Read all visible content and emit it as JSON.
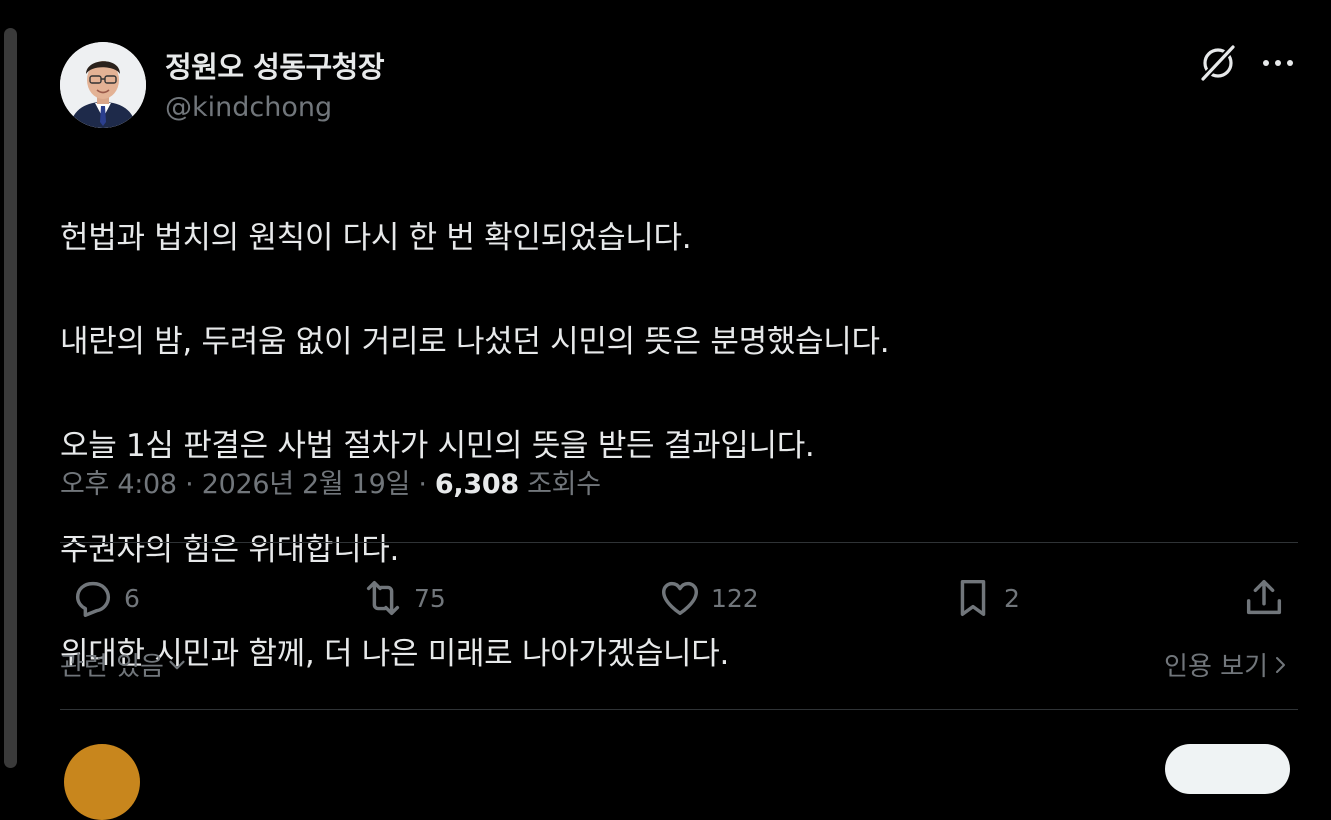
{
  "author": {
    "display_name": "정원오 성동구청장",
    "handle": "@kindchong"
  },
  "header_icons": [
    "grok-icon",
    "more-icon"
  ],
  "post": {
    "lines": [
      "헌법과 법치의 원칙이 다시 한 번 확인되었습니다.",
      "내란의 밤, 두려움 없이 거리로 나섰던 시민의 뜻은 분명했습니다.",
      "오늘 1심 판결은 사법 절차가 시민의 뜻을 받든 결과입니다.",
      "주권자의 힘은 위대합니다.",
      "위대한 시민과 함께, 더 나은 미래로 나아가겠습니다."
    ]
  },
  "meta": {
    "time": "오후 4:08",
    "separator": "·",
    "date": "2026년 2월 19일",
    "views": "6,308",
    "views_label": "조회수"
  },
  "actions": {
    "replies": "6",
    "reposts": "75",
    "likes": "122",
    "bookmarks": "2"
  },
  "footer": {
    "related_label": "관련 있음",
    "quotes_label": "인용 보기"
  },
  "colors": {
    "background": "#000000",
    "text": "#e7e9ea",
    "muted": "#71767b",
    "divider": "#2f3336"
  }
}
